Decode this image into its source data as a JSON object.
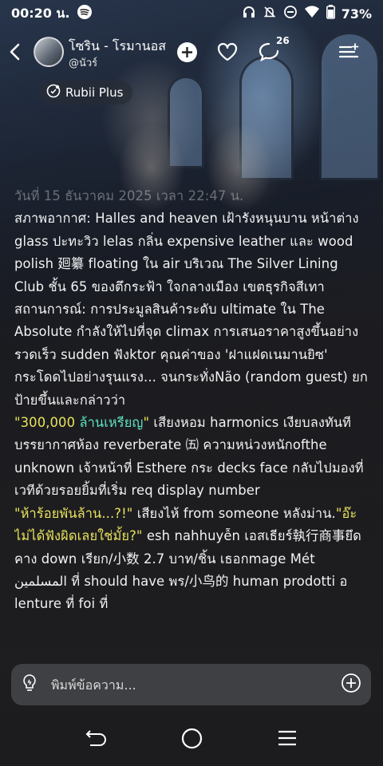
{
  "status_bar": {
    "time": "00:20 น.",
    "battery": "73%",
    "icons": [
      "spotify-icon",
      "headphones-icon",
      "bell-off-icon",
      "dnd-icon",
      "wifi-icon",
      "battery-icon"
    ]
  },
  "header": {
    "title": "โซริน - โรมานอส",
    "subtitle": "@นัวร์",
    "comment_count": "26"
  },
  "plus_badge": {
    "label": "Rubii Plus"
  },
  "content": {
    "date_line": "วันที่ 15 ธันวาคม 2025 เวลา 22:47 น.",
    "weather_line": "สภาพอากาศ: Halles and heaven เฝ้ารังหนุนบาน หน้าต่าง glass ปะทะวิว lelas กลิ่น expensive leather และ wood polish 廻纂 floating ใน air บริเวณ The Silver Lining Club ชั้น 65 ของตึกระฟ้า ใจกลางเมือง เขตธุรกิจสีเทา",
    "situation_line": "สถานการณ์: การประมูลสินค้าระดับ ultimate ใน The Absolute กำลังให้ไปที่จุด climax การเสนอราคาสูงขึ้นอย่างรวดเร็ว  sudden ฟังktor คุณค่าของ 'ฝาแฝดเนมานยิซ' กระโดดไปอย่างรุนแรง... จนกระทั่งNão (random guest) ยกป้ายขึ้นและกล่าวว่า",
    "quote1_prefix": "\"300,000 ",
    "quote1_teal": "ล้านเหรียญ",
    "quote1_suffix": "\"",
    "after_quote1": " เสียงหอม harmonics เงียบลงทันที บรรยากาศห้อง reverberate ㈤ ความหน่วงหนักofthe unknown เจ้าหน้าที่ Esthere กระ decks face กลับไปมองที่เวทีด้วยรอยยิ้มที่เริ่ม req display number",
    "quote2": "\"ห้าร้อยพันล้าน...?!\"",
    "after_quote2": " เสียงไห้ from someone หลังม่าน.",
    "quote3": "\"อ๊ะไม่ได้ฟังผิดเลยใช่มั้ย?\"",
    "after_quote3": " esh nahhuyễn เอสเธียร์執行商事ยึดคาง down เรียก/小数 2.7 บาท/ชิ้น เธอกmage  Mét المسلمين ที่ should have พร/小鸟的 human prodotti อ lenture ที่ foi ที่"
  },
  "input": {
    "placeholder": "พิมพ์ข้อความ..."
  },
  "colors": {
    "highlight_yellow": "#e8e25c",
    "highlight_teal": "#5ee0c2",
    "input_bg": "#3f4044",
    "nav_bg": "#1c1c1e"
  }
}
